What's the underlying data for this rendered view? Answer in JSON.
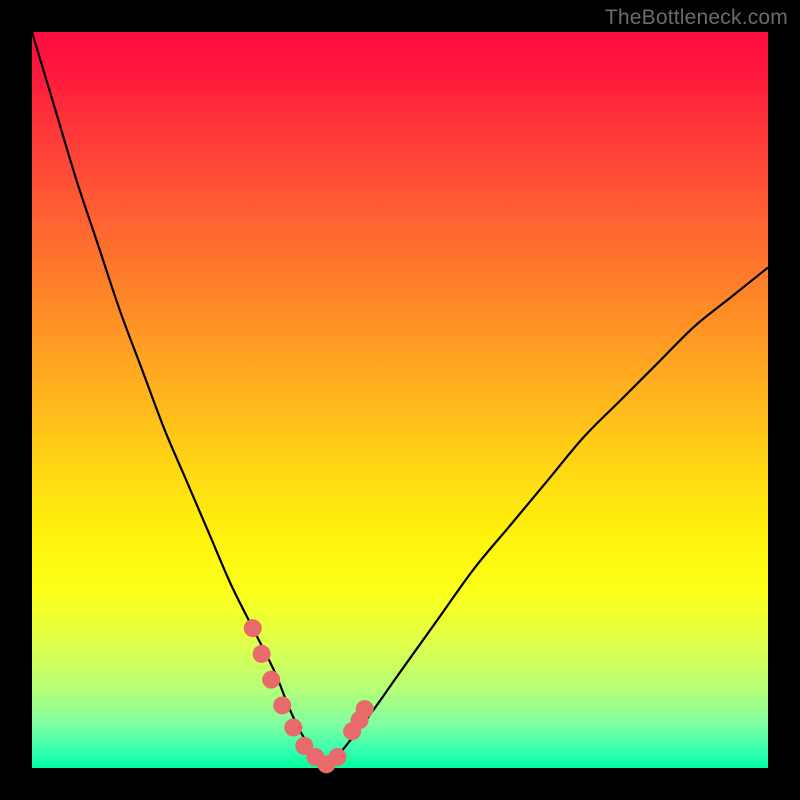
{
  "watermark": "TheBottleneck.com",
  "colors": {
    "background": "#000000",
    "curve_stroke": "#000000",
    "marker_fill": "#e86a6a",
    "marker_stroke": "#d85a5a"
  },
  "chart_data": {
    "type": "line",
    "title": "",
    "xlabel": "",
    "ylabel": "",
    "xlim": [
      0,
      100
    ],
    "ylim": [
      0,
      100
    ],
    "grid": false,
    "annotations": [
      "TheBottleneck.com"
    ],
    "series": [
      {
        "name": "bottleneck-curve",
        "x": [
          0,
          3,
          6,
          9,
          12,
          15,
          18,
          21,
          24,
          27,
          30,
          33,
          35,
          37,
          39,
          40,
          45,
          50,
          55,
          60,
          65,
          70,
          75,
          80,
          85,
          90,
          95,
          100
        ],
        "y": [
          100,
          90,
          80,
          71,
          62,
          54,
          46,
          39,
          32,
          25,
          19,
          13,
          8,
          4,
          1,
          0,
          6,
          13,
          20,
          27,
          33,
          39,
          45,
          50,
          55,
          60,
          64,
          68
        ]
      }
    ],
    "markers": {
      "name": "highlighted-points",
      "x": [
        30.0,
        31.2,
        32.5,
        34.0,
        35.5,
        37.0,
        38.5,
        40.0,
        41.5,
        43.5,
        44.5,
        45.2
      ],
      "y": [
        19.0,
        15.5,
        12.0,
        8.5,
        5.5,
        3.0,
        1.5,
        0.5,
        1.5,
        5.0,
        6.5,
        8.0
      ]
    }
  }
}
